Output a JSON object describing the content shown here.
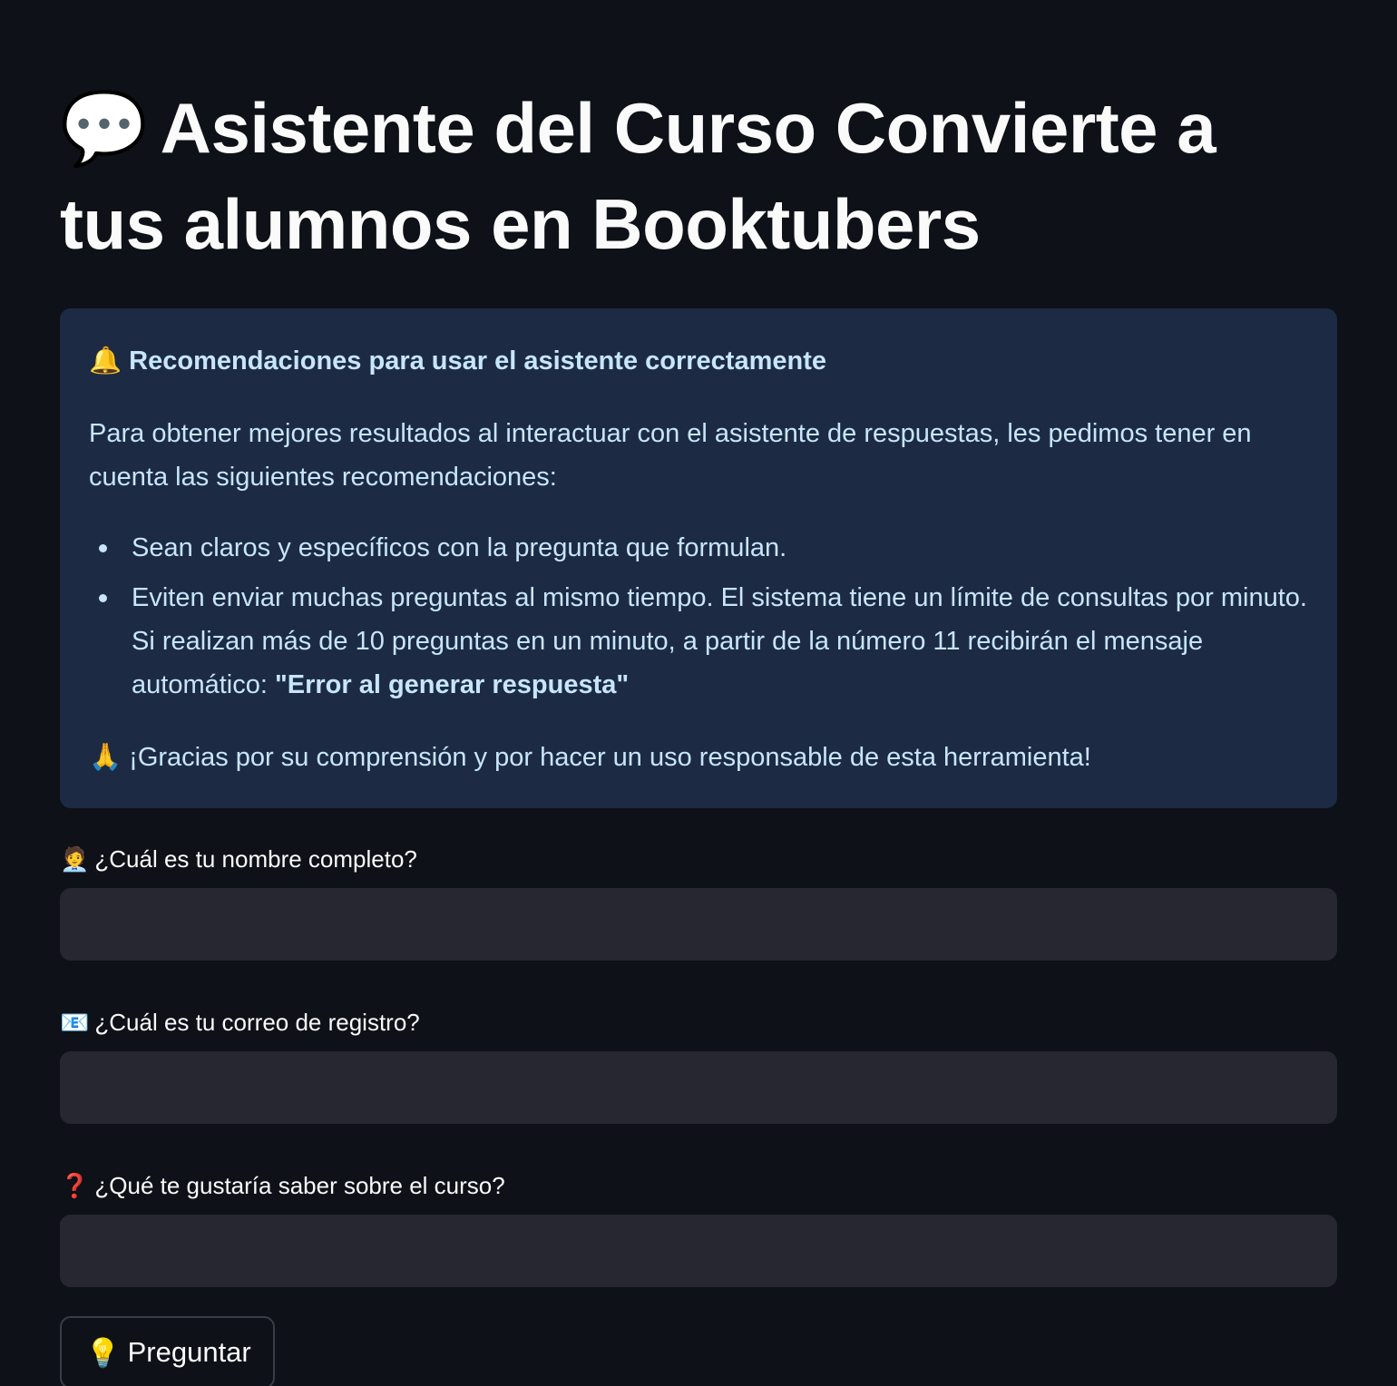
{
  "header": {
    "title_icon": "💬",
    "title": "Asistente del Curso Convierte a tus alumnos en Booktubers"
  },
  "info_box": {
    "heading_icon": "🔔",
    "heading": "Recomendaciones para usar el asistente correctamente",
    "intro": "Para obtener mejores resultados al interactuar con el asistente de respuestas, les pedimos tener en cuenta las siguientes recomendaciones:",
    "items": [
      "Sean claros y específicos con la pregunta que formulan.",
      "Eviten enviar muchas preguntas al mismo tiempo. El sistema tiene un límite de consultas por minuto. Si realizan más de 10 preguntas en un minuto, a partir de la número 11 recibirán el mensaje automático: "
    ],
    "error_message": "\"Error al generar respuesta\"",
    "thanks_icon": "🙏",
    "thanks": "¡Gracias por su comprensión y por hacer un uso responsable de esta herramienta!"
  },
  "form": {
    "name": {
      "icon": "🧑‍💼",
      "label": "¿Cuál es tu nombre completo?",
      "value": "",
      "placeholder": ""
    },
    "email": {
      "icon": "📧",
      "label": "¿Cuál es tu correo de registro?",
      "value": "",
      "placeholder": ""
    },
    "question": {
      "icon": "❓",
      "label": "¿Qué te gustaría saber sobre el curso?",
      "value": "",
      "placeholder": ""
    },
    "submit": {
      "icon": "💡",
      "label": "Preguntar"
    }
  },
  "colors": {
    "background": "#0e1117",
    "info_background": "#1c2b43",
    "info_text": "#c7e5fb",
    "input_background": "#262730",
    "text": "#fafafa"
  }
}
